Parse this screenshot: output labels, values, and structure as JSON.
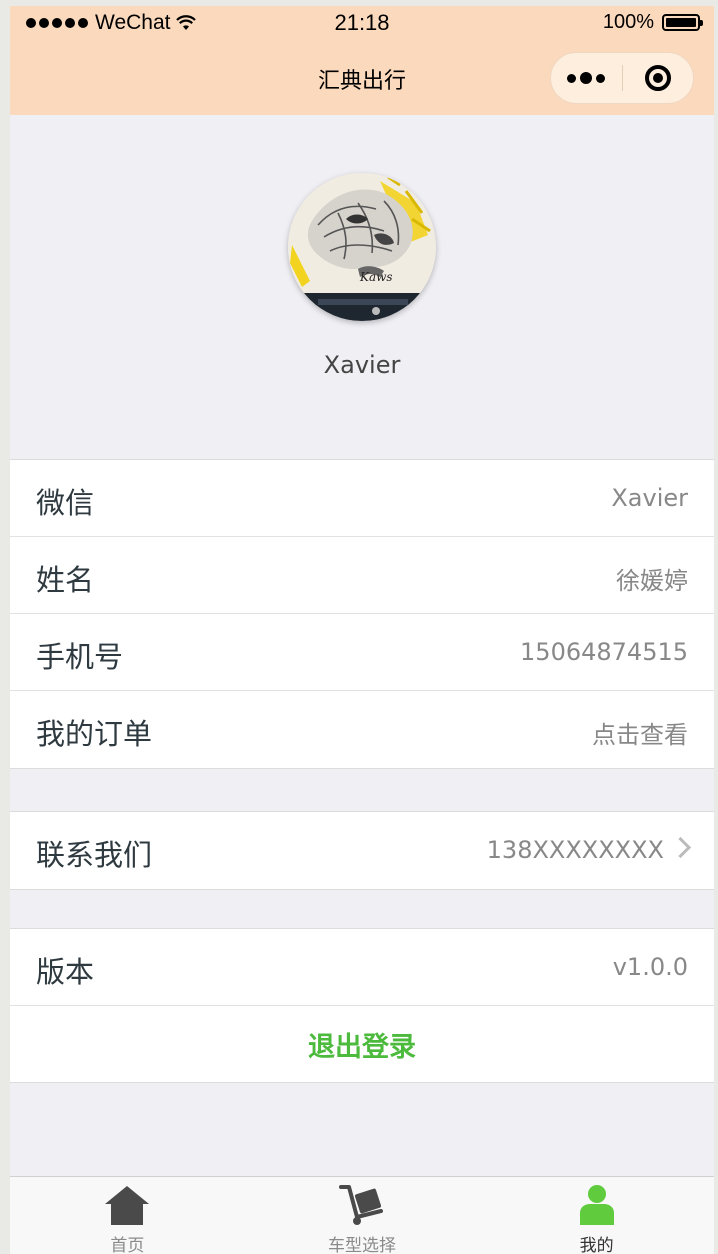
{
  "status_bar": {
    "carrier": "WeChat",
    "time": "21:18",
    "battery": "100%"
  },
  "nav": {
    "title": "汇典出行"
  },
  "profile": {
    "username": "Xavier"
  },
  "info_rows": [
    {
      "label": "微信",
      "value": "Xavier"
    },
    {
      "label": "姓名",
      "value": "徐媛婷"
    },
    {
      "label": "手机号",
      "value": "15064874515"
    },
    {
      "label": "我的订单",
      "value": "点击查看"
    }
  ],
  "contact": {
    "label": "联系我们",
    "value": "138XXXXXXXX"
  },
  "version": {
    "label": "版本",
    "value": "v1.0.0"
  },
  "logout_label": "退出登录",
  "tabbar": [
    {
      "label": "首页",
      "icon": "home-icon",
      "active": false
    },
    {
      "label": "车型选择",
      "icon": "cart-icon",
      "active": false
    },
    {
      "label": "我的",
      "icon": "user-icon",
      "active": true
    }
  ],
  "colors": {
    "header_bg": "#fbd9bd",
    "accent_green": "#4cba3c",
    "page_bg": "#efeff4"
  }
}
